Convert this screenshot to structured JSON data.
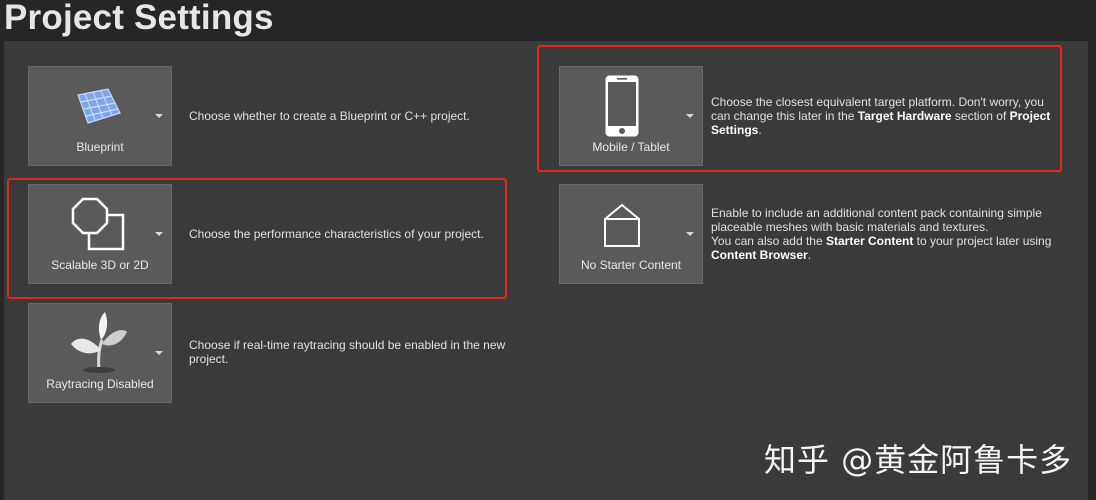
{
  "page_title": "Project Settings",
  "tiles": {
    "blueprint": {
      "label": "Blueprint",
      "icon": "blueprint-grid-icon"
    },
    "scalable": {
      "label": "Scalable 3D or 2D",
      "icon": "scalable-shapes-icon"
    },
    "raytracing": {
      "label": "Raytracing Disabled",
      "icon": "plant-icon"
    },
    "mobile": {
      "label": "Mobile / Tablet",
      "icon": "phone-icon"
    },
    "starter": {
      "label": "No Starter Content",
      "icon": "open-box-icon"
    }
  },
  "descriptions": {
    "blueprint": "Choose whether to create a Blueprint or C++ project.",
    "scalable": "Choose the performance characteristics of your project.",
    "raytracing_line1": "Choose if real-time raytracing should be enabled in the new",
    "raytracing_line2": "project.",
    "mobile": {
      "line1": "Choose the closest equivalent target platform. Don't worry, you",
      "line2_pre": "can change this later in the ",
      "line2_bold1": "Target Hardware",
      "line2_mid": " section of ",
      "line2_bold2": "Project",
      "line3_bold": "Settings",
      "line3_post": "."
    },
    "starter": {
      "line1": "Enable to include an additional content pack containing simple",
      "line2": "placeable meshes with basic materials and textures.",
      "line3_pre": "You can also add the ",
      "line3_bold": "Starter Content",
      "line3_post": " to your project later using",
      "line4_bold": "Content Browser",
      "line4_post": "."
    }
  },
  "watermark": "知乎 @黄金阿鲁卡多",
  "colors": {
    "highlight": "#e0261d",
    "panel": "#3a3a3a",
    "tile": "#5a5a5a",
    "background": "#262626"
  }
}
